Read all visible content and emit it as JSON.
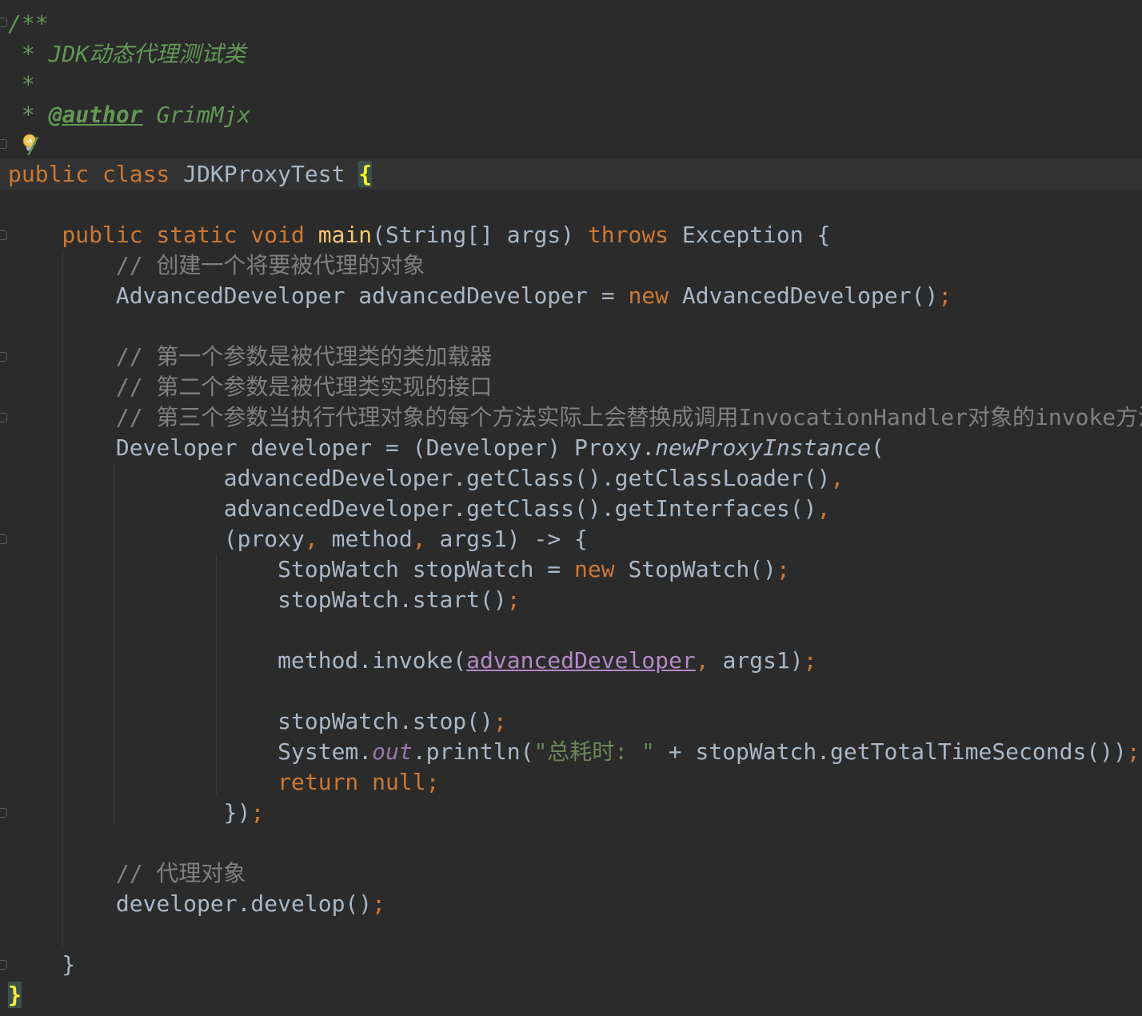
{
  "editor": {
    "lines": {
      "l01": {
        "a": "/**"
      },
      "l02": {
        "a": " * JDK动态代理测试类"
      },
      "l03": {
        "a": " *"
      },
      "l04": {
        "a": " * ",
        "b": "@author",
        "c": " GrimMjx"
      },
      "l05": {
        "a": "/"
      },
      "l06": {
        "a": "public class ",
        "b": "JDKProxyTest ",
        "c": "{"
      },
      "l08": {
        "a": "    public static void ",
        "b": "main",
        "c": "(String[] args) ",
        "d": "throws ",
        "e": "Exception {"
      },
      "l09": {
        "a": "        // 创建一个将要被代理的对象"
      },
      "l10": {
        "a": "        AdvancedDeveloper advancedDeveloper = ",
        "b": "new ",
        "c": "AdvancedDeveloper()",
        "d": ";"
      },
      "l12": {
        "a": "        // 第一个参数是被代理类的类加载器"
      },
      "l13": {
        "a": "        // 第二个参数是被代理类实现的接口"
      },
      "l14": {
        "a": "        // 第三个参数当执行代理对象的每个方法实际上会替换成调用InvocationHandler对象的invoke方法"
      },
      "l15": {
        "a": "        Developer developer = (Developer) Proxy.",
        "b": "newProxyInstance",
        "c": "("
      },
      "l16": {
        "a": "                advancedDeveloper.getClass().getClassLoader()",
        "b": ","
      },
      "l17": {
        "a": "                advancedDeveloper.getClass().getInterfaces()",
        "b": ","
      },
      "l18": {
        "a": "                (proxy",
        "b": ", ",
        "c": "method",
        "d": ", ",
        "e": "args1) -> {"
      },
      "l19": {
        "a": "                    StopWatch stopWatch = ",
        "b": "new ",
        "c": "StopWatch()",
        "d": ";"
      },
      "l20": {
        "a": "                    stopWatch.start()",
        "b": ";"
      },
      "l22": {
        "a": "                    method.invoke(",
        "b": "advancedDeveloper",
        "c": ", ",
        "d": "args1)",
        "e": ";"
      },
      "l24": {
        "a": "                    stopWatch.stop()",
        "b": ";"
      },
      "l25": {
        "a": "                    System.",
        "b": "out",
        "c": ".println(",
        "d": "\"总耗时: \"",
        "e": " + stopWatch.getTotalTimeSeconds())",
        "f": ";"
      },
      "l26": {
        "a": "                    return null",
        "b": ";"
      },
      "l27": {
        "a": "                })",
        "b": ";"
      },
      "l29": {
        "a": "        // 代理对象"
      },
      "l30": {
        "a": "        developer.develop()",
        "b": ";"
      },
      "l32": {
        "a": "    }"
      },
      "l33": {
        "a": "}"
      }
    },
    "icons": {
      "intention_bulb": "lightbulb-icon"
    },
    "colors": {
      "background": "#2b2b2b",
      "keyword": "#cc7832",
      "text": "#a9b7c6",
      "javadoc": "#629755",
      "comment": "#808080",
      "method_decl": "#ffc66d",
      "static_field": "#9876aa",
      "string": "#6a8759",
      "brace_match": "#ffef28"
    }
  }
}
